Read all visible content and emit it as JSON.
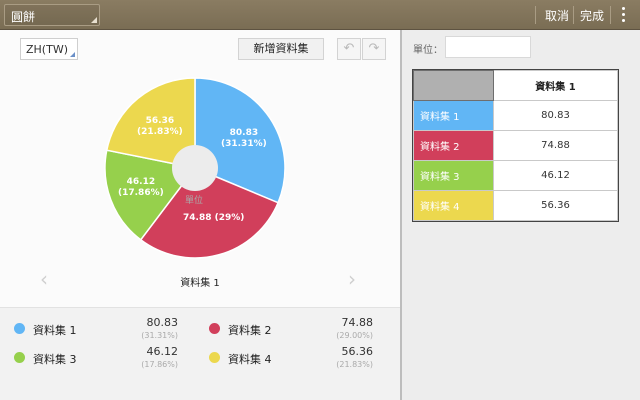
{
  "toolbar": {
    "title": "圓餅",
    "cancel": "取消",
    "done": "完成"
  },
  "controls": {
    "language": "ZH(TW)",
    "add_dataset": "新增資料集",
    "undo_icon": "undo-icon",
    "redo_icon": "redo-icon"
  },
  "colors": {
    "blue": "#61b6f5",
    "red": "#d13f5b",
    "green": "#96d04c",
    "yellow": "#ecd84e"
  },
  "chart_data": {
    "type": "pie",
    "title": "資料集 1",
    "center_label": "單位",
    "categories": [
      "資料集 1",
      "資料集 2",
      "資料集 3",
      "資料集 4"
    ],
    "values": [
      80.83,
      74.88,
      46.12,
      56.36
    ],
    "percent_labels": [
      "31.31%",
      "29%",
      "17.86%",
      "21.83%"
    ],
    "slice_labels": [
      "80.83\n(31.31%)",
      "74.88 (29%)",
      "46.12\n(17.86%)",
      "56.36\n(21.83%)"
    ]
  },
  "legend": [
    {
      "name": "資料集 1",
      "value": "80.83",
      "pct": "(31.31%)"
    },
    {
      "name": "資料集 2",
      "value": "74.88",
      "pct": "(29.00%)"
    },
    {
      "name": "資料集 3",
      "value": "46.12",
      "pct": "(17.86%)"
    },
    {
      "name": "資料集 4",
      "value": "56.36",
      "pct": "(21.83%)"
    }
  ],
  "table": {
    "unit_label": "單位：",
    "unit_value": "",
    "column_header": "資料集 1",
    "rows": [
      {
        "label": "資料集 1",
        "value": "80.83"
      },
      {
        "label": "資料集 2",
        "value": "74.88"
      },
      {
        "label": "資料集 3",
        "value": "46.12"
      },
      {
        "label": "資料集 4",
        "value": "56.36"
      }
    ]
  }
}
